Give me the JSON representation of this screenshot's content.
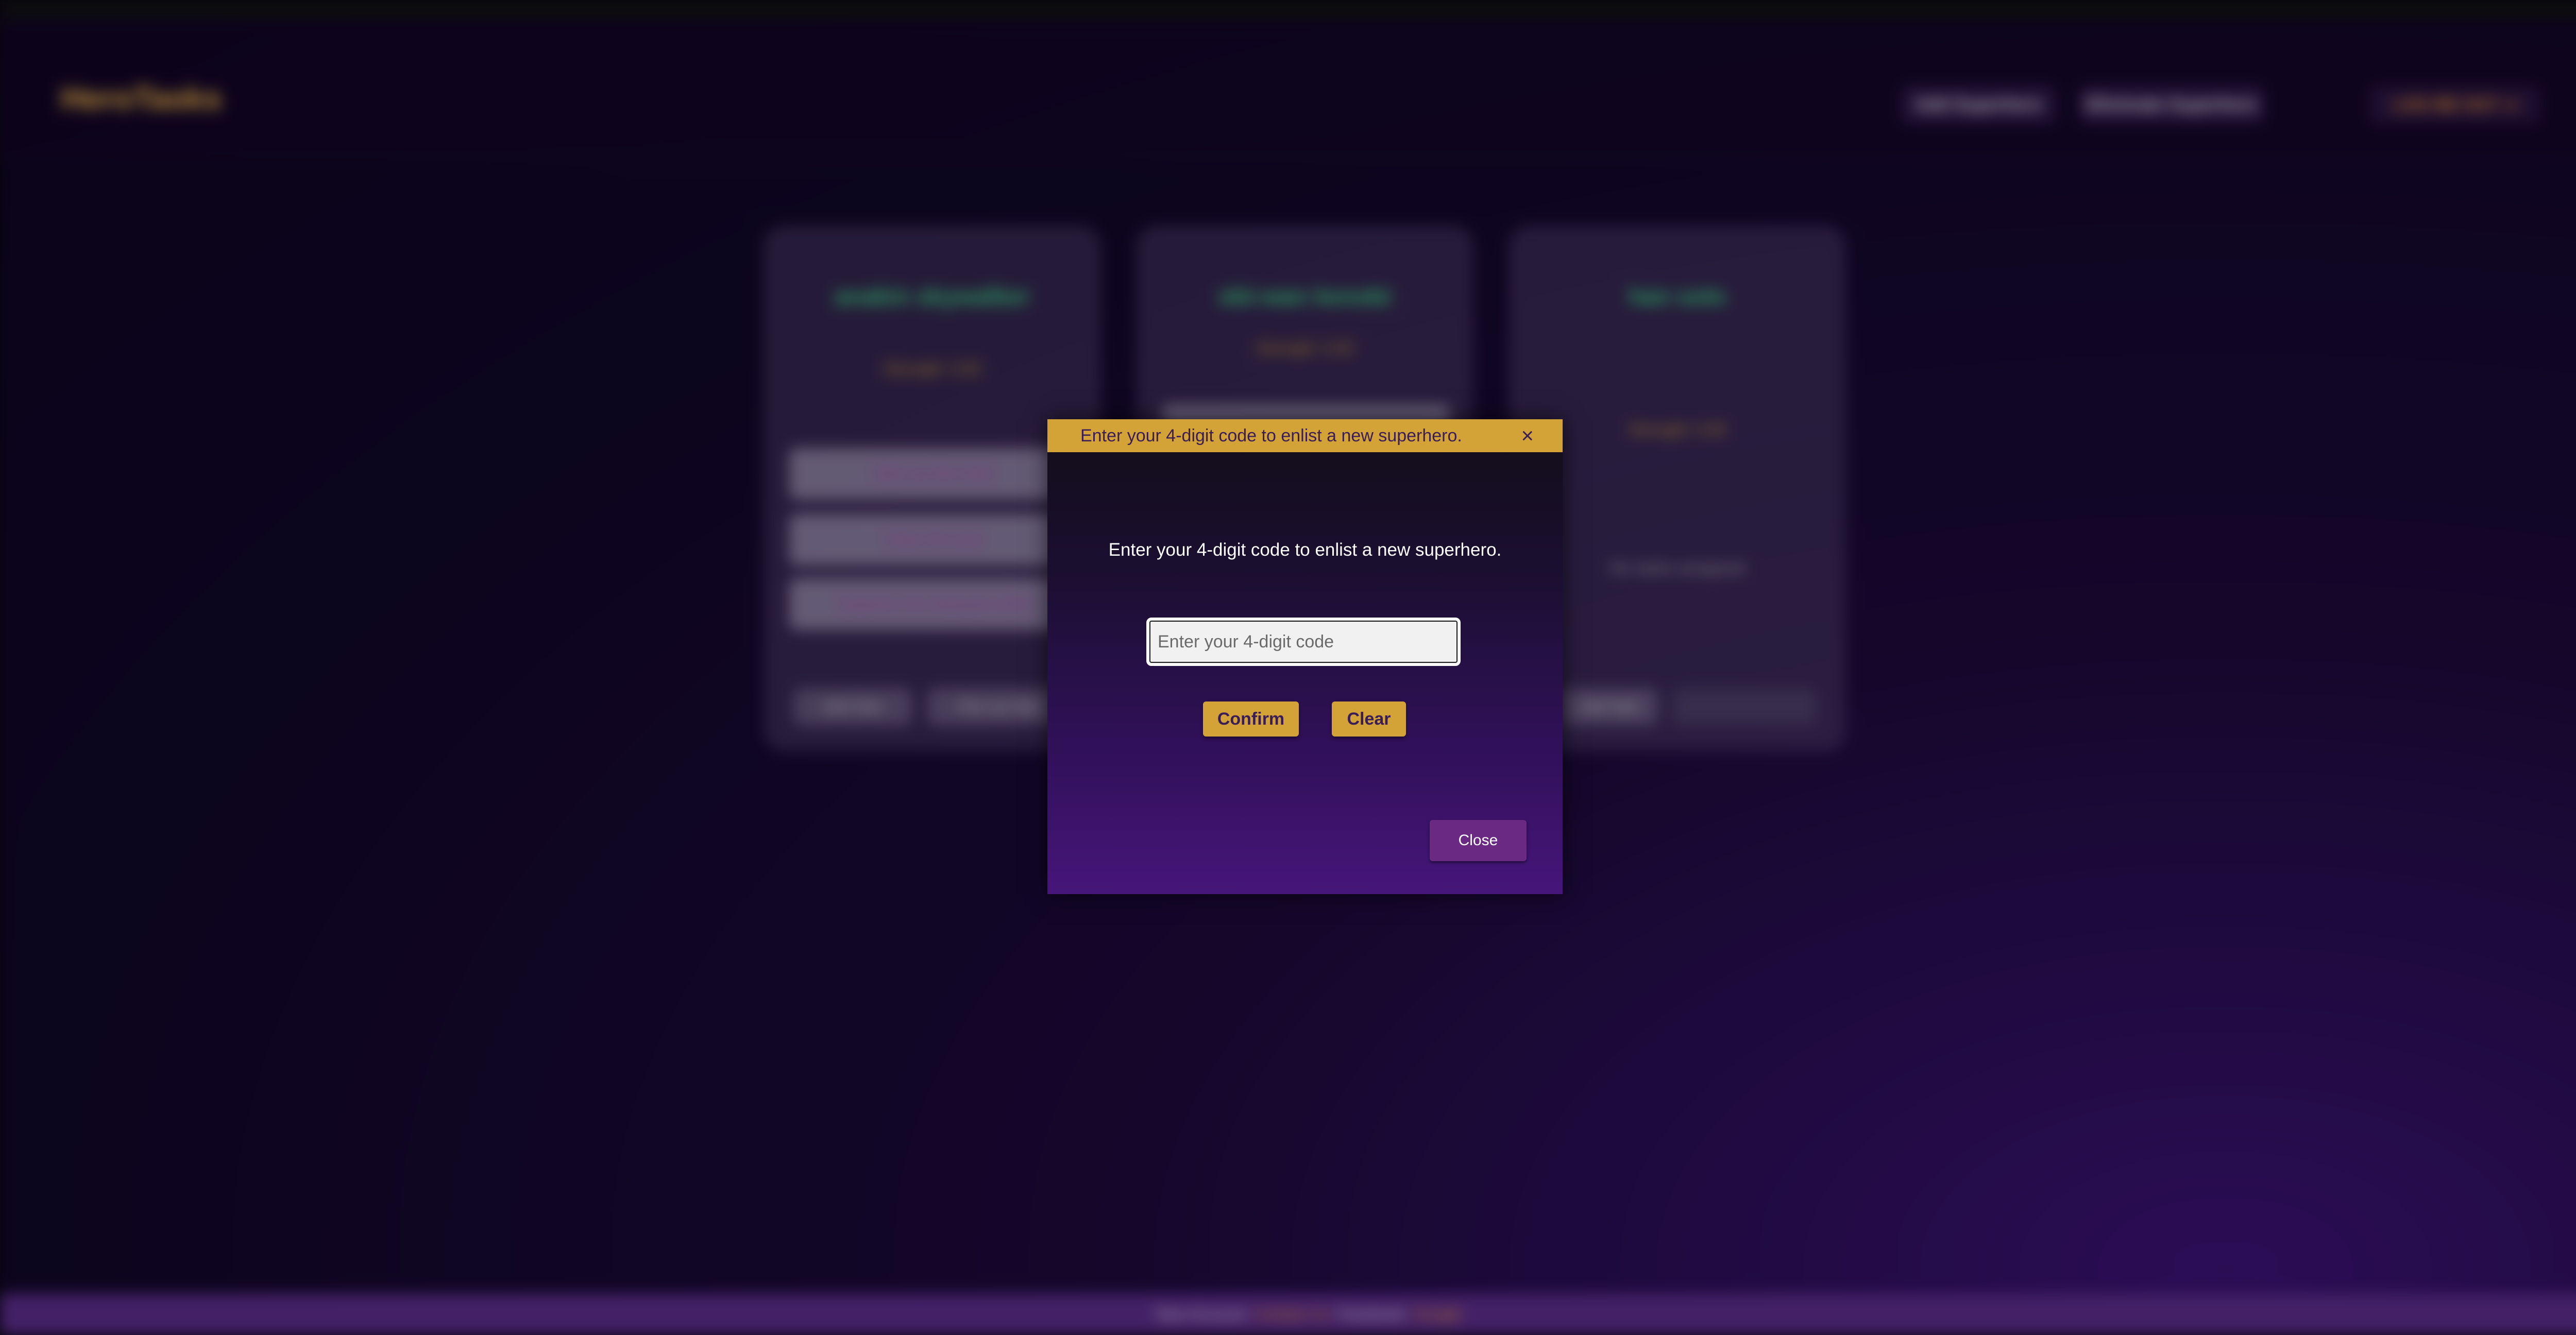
{
  "app": {
    "brand": "HeroTasks",
    "nav": {
      "add_label": "Add Superhero",
      "eliminate_label": "Eliminate Superhero",
      "logout_label": "LOG ME OUT"
    },
    "heroes": [
      {
        "name": "anakin skywalker",
        "strength": "Strength: 0.00",
        "tasks": [
          "Take out the trash",
          "Clean the pool",
          "Organize the backyard shed"
        ],
        "add_task_label": "Add Task",
        "secondary_label": "Pick Up Task"
      },
      {
        "name": "obi-wan kenobi",
        "strength": "Strength: 0.00"
      },
      {
        "name": "han solo",
        "strength": "Strength: 0.00",
        "empty_label": "No tasks assigned",
        "add_task_label": "Add Task"
      }
    ],
    "footer": {
      "new_account": "New Account",
      "contact": "Contact Us",
      "facebook": "Facebook",
      "google": "Google"
    }
  },
  "modal": {
    "title": "Enter your 4-digit code to enlist a new superhero.",
    "message": "Enter your 4-digit code to enlist a new superhero.",
    "input_placeholder": "Enter your 4-digit code",
    "input_value": "",
    "confirm_label": "Confirm",
    "clear_label": "Clear",
    "close_label": "Close",
    "close_icon": "×"
  },
  "colors": {
    "gold": "#d4a338",
    "purple_text": "#3a1d57",
    "close_button": "#6a2a84",
    "hero_name": "#39d17a"
  }
}
